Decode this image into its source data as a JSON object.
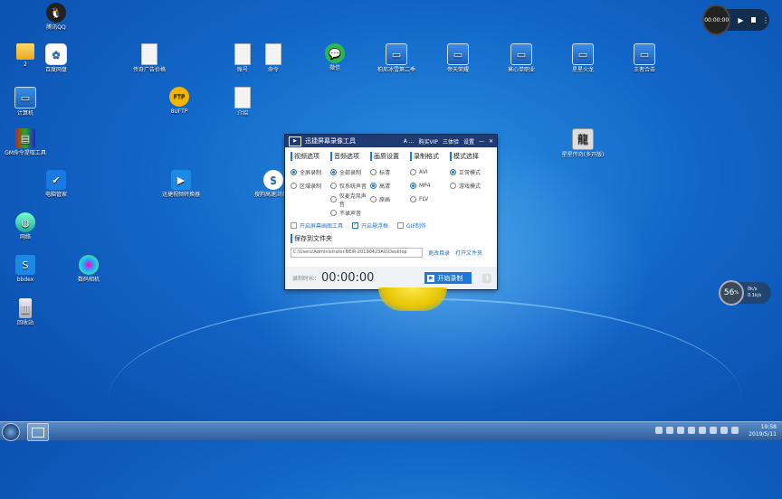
{
  "desktop": {
    "icons": [
      {
        "label": "腾讯QQ",
        "type": "qq",
        "glyph": "🐧"
      },
      {
        "label": "2",
        "type": "folder",
        "glyph": ""
      },
      {
        "label": "百度网盘",
        "type": "baidu",
        "glyph": "✿"
      },
      {
        "label": "计算机",
        "type": "pc",
        "glyph": "▭"
      },
      {
        "label": "GM命令提取工具",
        "type": "winrar",
        "glyph": "▤"
      },
      {
        "label": "电脑管家",
        "type": "shield",
        "glyph": "✔"
      },
      {
        "label": "网络",
        "type": "net",
        "glyph": "◍"
      },
      {
        "label": "bbdex",
        "type": "blue",
        "glyph": "S"
      },
      {
        "label": "回收站",
        "type": "trash",
        "glyph": "▥"
      },
      {
        "label": "传奇广告价格",
        "type": "file",
        "glyph": ""
      },
      {
        "label": "8UFTP",
        "type": "ftp",
        "glyph": "FTP"
      },
      {
        "label": "数码相机",
        "type": "flower",
        "glyph": ""
      },
      {
        "label": "账号",
        "type": "file",
        "glyph": ""
      },
      {
        "label": "命令",
        "type": "file",
        "glyph": ""
      },
      {
        "label": "介绍",
        "type": "file",
        "glyph": ""
      },
      {
        "label": "迅捷视频转换器",
        "type": "blue",
        "glyph": "▶"
      },
      {
        "label": "微信",
        "type": "green",
        "glyph": "💬"
      },
      {
        "label": "搜狗高速浏览器",
        "type": "sogou",
        "glyph": "S"
      },
      {
        "label": "柏尼冰雪第二季",
        "type": "pc",
        "glyph": "▭"
      },
      {
        "label": "帝天荣耀",
        "type": "pc",
        "glyph": "▭"
      },
      {
        "label": "莫心单职业",
        "type": "pc",
        "glyph": "▭"
      },
      {
        "label": "星星火龙",
        "type": "pc",
        "glyph": "▭"
      },
      {
        "label": "王者合击",
        "type": "pc",
        "glyph": "▭"
      },
      {
        "label": "星星传奇(多开版)",
        "type": "dragon",
        "glyph": "龍"
      }
    ],
    "colors": {
      "background": "#1166c8",
      "accent": "#1e78d8"
    }
  },
  "recorder_overlay": {
    "time": "00:00:00",
    "play_icon": "▶",
    "more_icon": "⋮"
  },
  "net_widget": {
    "percent": "56",
    "unit": "%",
    "up": "0k/s",
    "down": "0.1k/s"
  },
  "app": {
    "title": "迅捷屏幕录像工具",
    "account": "A ...",
    "buy": "购买VIP",
    "menu": "三体验",
    "settings": "设置",
    "sections": [
      {
        "heading": "视频选项",
        "options": [
          {
            "label": "全屏录制",
            "on": true
          },
          {
            "label": "区域录制",
            "on": false
          }
        ]
      },
      {
        "heading": "音频选项",
        "options": [
          {
            "label": "全部录制",
            "on": true
          },
          {
            "label": "仅系统声音",
            "on": false
          },
          {
            "label": "仅麦克风声音",
            "on": false
          },
          {
            "label": "不录声音",
            "on": false
          }
        ]
      },
      {
        "heading": "画质设置",
        "options": [
          {
            "label": "标清",
            "on": false
          },
          {
            "label": "高清",
            "on": true
          },
          {
            "label": "原画",
            "on": false
          }
        ]
      },
      {
        "heading": "录制格式",
        "options": [
          {
            "label": "AVI",
            "on": false
          },
          {
            "label": "MP4",
            "on": true
          },
          {
            "label": "FLV",
            "on": false
          }
        ]
      },
      {
        "heading": "模式选择",
        "options": [
          {
            "label": "正常模式",
            "on": true
          },
          {
            "label": "游戏模式",
            "on": false
          }
        ]
      }
    ],
    "checks": [
      {
        "label": "开启屏幕画图工具",
        "on": false
      },
      {
        "label": "开启悬浮框",
        "on": true
      },
      {
        "label": "GIF制作",
        "on": false
      }
    ],
    "save_heading": "保存到文件夹",
    "path": "C:\\Users\\Administrator.BEIR-20190423AU\\Desktop",
    "change_dir": "更改目录",
    "open_dir": "打开文件夹",
    "rec_label": "录制时长：",
    "rec_time": "00:00:00",
    "start_label": "开始录制"
  },
  "taskbar": {
    "time": "19:58",
    "date": "2019/5/11"
  }
}
